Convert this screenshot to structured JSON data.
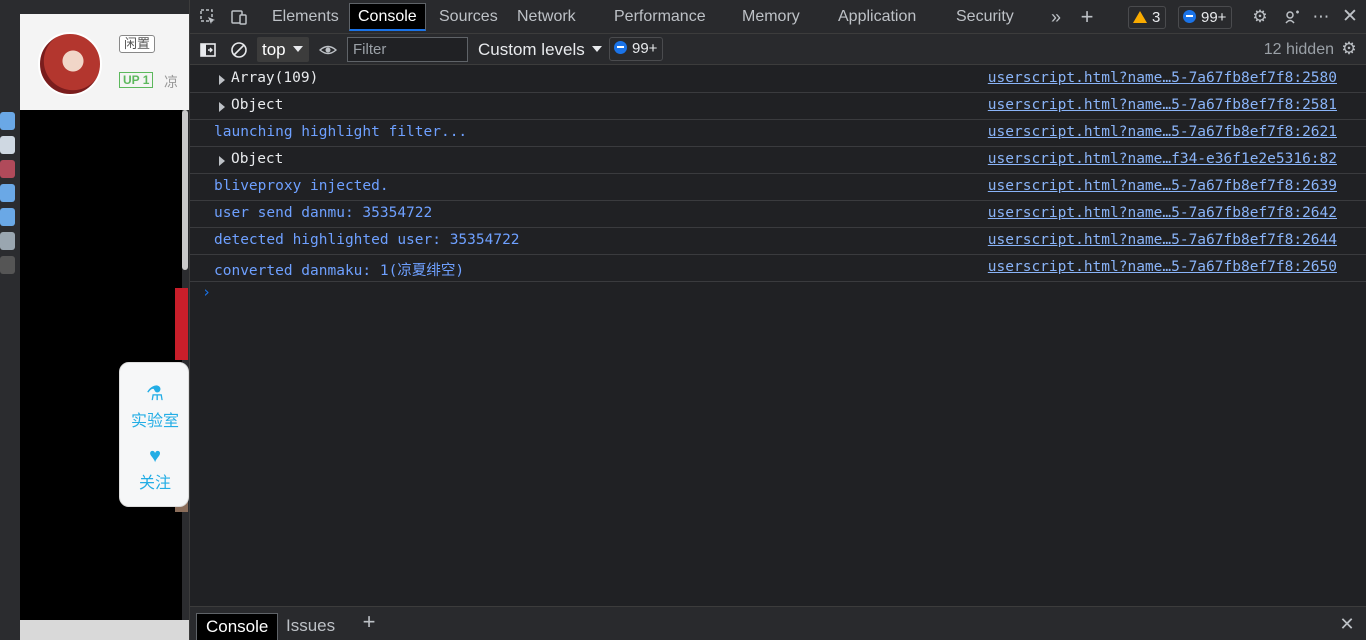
{
  "page": {
    "status_tag": "闲置",
    "up_badge": "UP 1",
    "up_name_fragment": "凉",
    "float_menu": [
      {
        "label": "实验室",
        "icon": "flask-icon"
      },
      {
        "label": "关注",
        "icon": "heart-icon"
      }
    ]
  },
  "devtools": {
    "tabs": [
      "Elements",
      "Console",
      "Sources",
      "Network",
      "Performance",
      "Memory",
      "Application",
      "Security"
    ],
    "active_tab": "Console",
    "warnings_count": "3",
    "messages_count": "99+",
    "toolbar": {
      "context": "top",
      "filter_placeholder": "Filter",
      "levels": "Custom levels",
      "messages_count": "99+",
      "hidden": "12 hidden"
    },
    "console_rows": [
      {
        "text": "Array(109)",
        "kind": "object",
        "source": "userscript.html?name…5-7a67fb8ef7f8:2580"
      },
      {
        "text": "Object",
        "kind": "object",
        "source": "userscript.html?name…5-7a67fb8ef7f8:2581"
      },
      {
        "text": "launching highlight filter...",
        "kind": "info",
        "source": "userscript.html?name…5-7a67fb8ef7f8:2621"
      },
      {
        "text": "Object",
        "kind": "object",
        "source": "userscript.html?name…f34-e36f1e2e5316:82"
      },
      {
        "text": "bliveproxy injected.",
        "kind": "info",
        "source": "userscript.html?name…5-7a67fb8ef7f8:2639"
      },
      {
        "text": "user send danmu: 35354722",
        "kind": "info",
        "source": "userscript.html?name…5-7a67fb8ef7f8:2642"
      },
      {
        "text": "detected highlighted user: 35354722",
        "kind": "info",
        "source": "userscript.html?name…5-7a67fb8ef7f8:2644"
      },
      {
        "text": "converted danmaku: 1(凉夏绯空)",
        "kind": "info",
        "source": "userscript.html?name…5-7a67fb8ef7f8:2650"
      }
    ],
    "prompt_symbol": "›",
    "drawer_tabs": [
      "Console",
      "Issues"
    ],
    "colors": {
      "accent": "#1a73e8",
      "info_text": "#6ea0ff",
      "link": "#8ab4f8",
      "warning": "#f9ab00"
    }
  }
}
